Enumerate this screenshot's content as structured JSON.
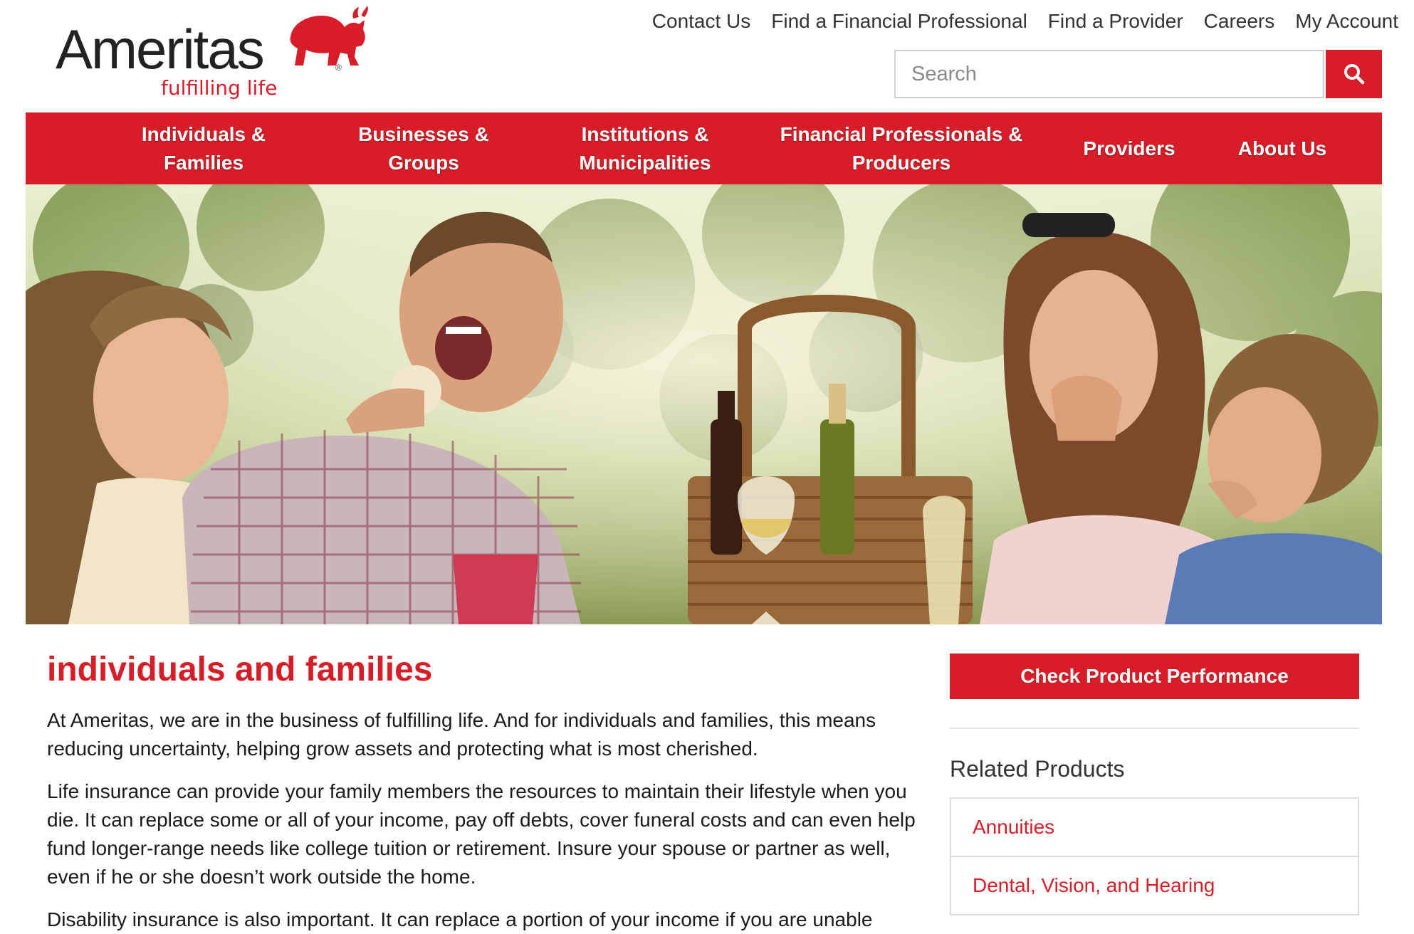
{
  "brand": {
    "name": "Ameritas",
    "registered": "®",
    "tagline": "fulfilling life",
    "accent_color": "#d71e28"
  },
  "utility_nav": [
    {
      "label": "Contact Us"
    },
    {
      "label": "Find a Financial Professional"
    },
    {
      "label": "Find a Provider"
    },
    {
      "label": "Careers"
    },
    {
      "label": "My Account"
    }
  ],
  "search": {
    "placeholder": "Search",
    "icon": "search-icon"
  },
  "main_nav": [
    {
      "line1": "Individuals &",
      "line2": "Families"
    },
    {
      "line1": "Businesses &",
      "line2": "Groups"
    },
    {
      "line1": "Institutions &",
      "line2": "Municipalities"
    },
    {
      "line1": "Financial Professionals &",
      "line2": "Producers"
    },
    {
      "line1": "Providers",
      "line2": ""
    },
    {
      "line1": "About Us",
      "line2": ""
    }
  ],
  "main": {
    "title": "individuals and families",
    "paragraphs": [
      "At Ameritas, we are in the business of fulfilling life. And for individuals and families, this means reducing uncertainty, helping grow assets and protecting what is most cherished.",
      "Life insurance can provide your family members the resources to maintain their lifestyle when you die. It can replace some or all of your income, pay off debts, cover funeral costs and can even help fund longer-range needs like college tuition or retirement. Insure your spouse or partner as well, even if he or she doesn’t work outside the home.",
      "Disability insurance is also important. It can replace a portion of your income if you are unable"
    ]
  },
  "sidebar": {
    "cta_label": "Check Product Performance",
    "related_heading": "Related Products",
    "related_items": [
      {
        "label": "Annuities"
      },
      {
        "label": "Dental, Vision, and Hearing"
      }
    ]
  }
}
